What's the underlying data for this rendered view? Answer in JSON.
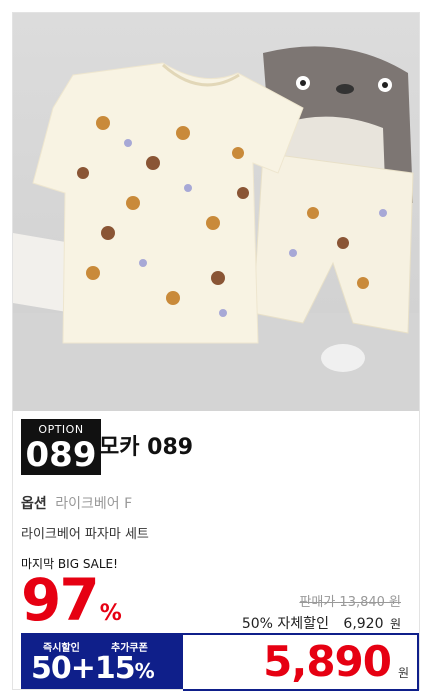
{
  "option": {
    "label": "OPTION",
    "number": "089"
  },
  "product": {
    "title": "모카 089",
    "option_key": "옵션",
    "option_value": "라이크베어 F",
    "description": "라이크베어 파자마 세트"
  },
  "sale": {
    "tag": "마지막 BIG SALE!",
    "discount_number": "97",
    "discount_sign": "%",
    "original_price_text": "판매가 13,840 원",
    "self_discount_label": "50% 자체할인",
    "self_discount_price": "6,920",
    "self_discount_unit": "원"
  },
  "coupon": {
    "instant_label": "즉시할인",
    "extra_label": "추가쿠폰",
    "combo": "50+15",
    "combo_sign": "%"
  },
  "final": {
    "price": "5,890",
    "unit": "원"
  },
  "colors": {
    "accent_red": "#e60012",
    "badge_blue": "#0f1f8a"
  }
}
